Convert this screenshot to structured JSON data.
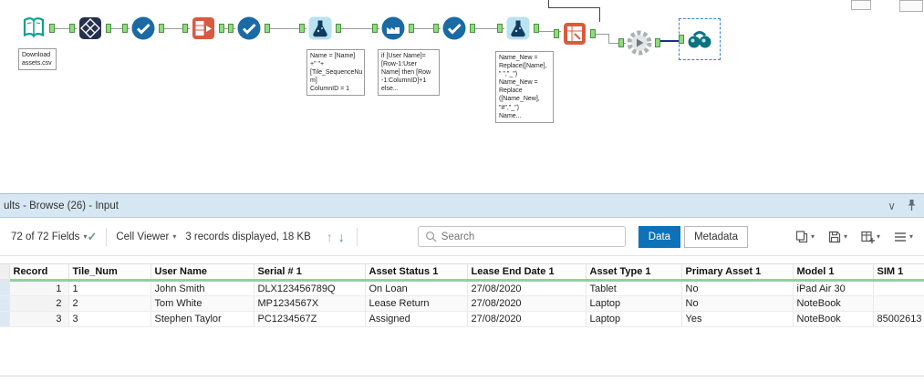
{
  "canvas": {
    "annotations": {
      "input": "Download\nassets.csv",
      "formula1": "Name = [Name]\n+\" \"+\n[Tile_SequenceNu\nm]\nColumnID = 1",
      "multirow": "if [User Name]=\n[Row-1:User\nName] then [Row\n-1:ColumnID]+1\nelse...",
      "formula2": "Name_New =\nReplace([Name],\n\" \",\"_\")\nName_New =\nReplace\n([Name_New],\n\"#\",\"_\")\nName..."
    },
    "tools": [
      "input-data",
      "tile",
      "select",
      "text-to-columns",
      "select",
      "formula",
      "multi-row-formula",
      "select",
      "formula",
      "cross-tab",
      "macro",
      "browse"
    ]
  },
  "results": {
    "title": "ults - Browse (26) - Input",
    "toolbar": {
      "fields_summary": "72 of 72 Fields",
      "cell_viewer_label": "Cell Viewer",
      "records_info": "3 records displayed, 18 KB",
      "search_placeholder": "Search",
      "data_button": "Data",
      "metadata_button": "Metadata"
    },
    "table": {
      "columns": [
        "Record",
        "Tile_Num",
        "User Name",
        "Serial # 1",
        "Asset Status 1",
        "Lease End Date 1",
        "Asset Type 1",
        "Primary Asset 1",
        "Model 1",
        "SIM 1"
      ],
      "rows": [
        [
          "1",
          "1",
          "John Smith",
          "DLX123456789Q",
          "On Loan",
          "27/08/2020",
          "Tablet",
          "No",
          "iPad Air 30",
          ""
        ],
        [
          "2",
          "2",
          "Tom White",
          "MP1234567X",
          "Lease Return",
          "27/08/2020",
          "Laptop",
          "No",
          "NoteBook",
          ""
        ],
        [
          "3",
          "3",
          "Stephen Taylor",
          "PC1234567Z",
          "Assigned",
          "27/08/2020",
          "Laptop",
          "Yes",
          "NoteBook",
          "85002613"
        ]
      ]
    }
  },
  "glyphs": {
    "caret_down": "▾",
    "arrow_up": "↑",
    "arrow_down": "↓",
    "check": "✓",
    "chevron_down": "∨"
  },
  "colors": {
    "accent_blue": "#0d72b9",
    "anchor_green": "#8edc7e",
    "quality_green": "#8fd19e",
    "panel_header_bg": "#d6e7f3"
  },
  "icons": [
    "search-icon",
    "copy-icon",
    "save-icon",
    "table-add-icon",
    "menu-icon",
    "pin-icon",
    "chevron-down-icon",
    "arrow-up-icon",
    "arrow-down-icon",
    "check-icon"
  ]
}
